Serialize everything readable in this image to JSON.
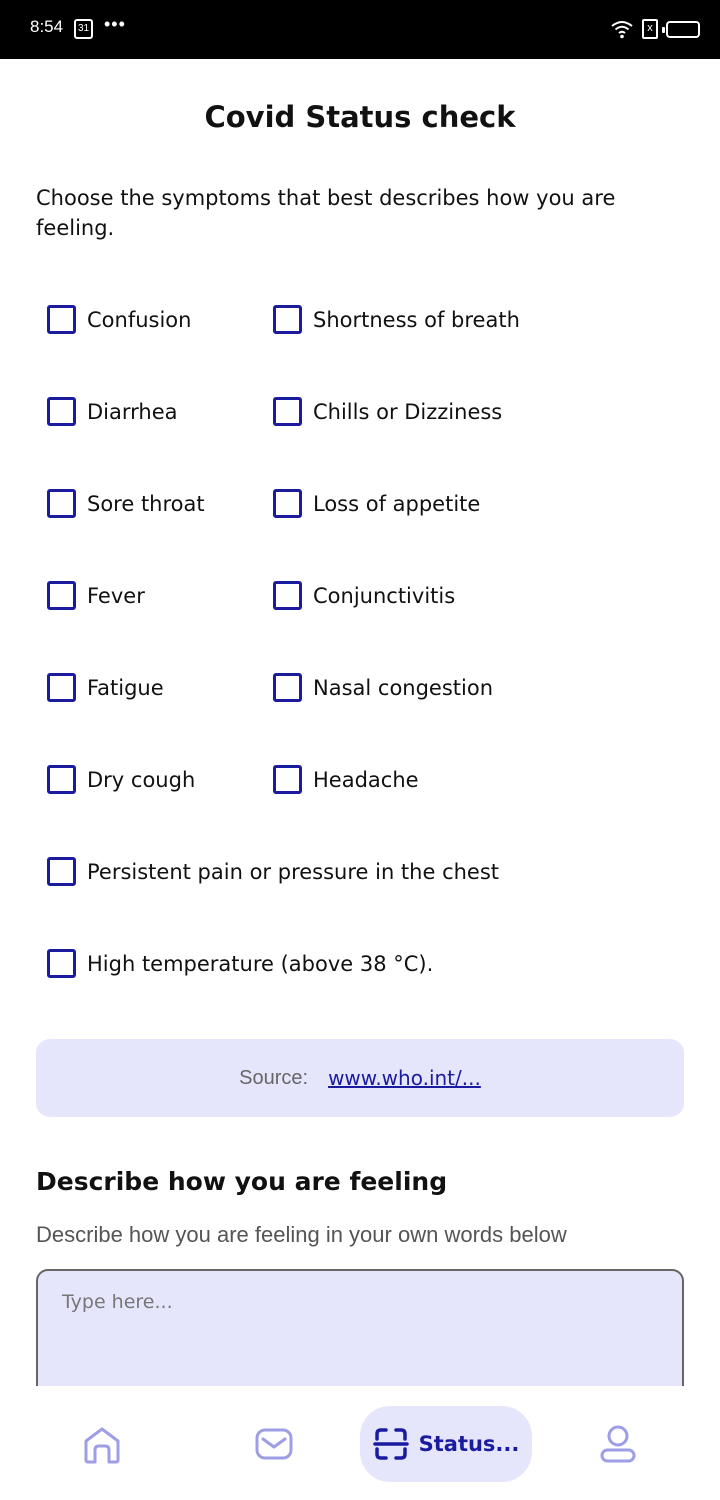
{
  "status_bar": {
    "time": "8:54",
    "calendar_day": "31",
    "dots": "•••",
    "sim_label": "x"
  },
  "header": {
    "title": "Covid Status check"
  },
  "intro": "Choose the symptoms that best describes how you are feeling.",
  "symptoms": [
    {
      "label": "Confusion",
      "checked": false
    },
    {
      "label": "Shortness of breath",
      "checked": false
    },
    {
      "label": "Diarrhea",
      "checked": false
    },
    {
      "label": "Chills or Dizziness",
      "checked": false
    },
    {
      "label": "Sore throat",
      "checked": false
    },
    {
      "label": "Loss of appetite",
      "checked": false
    },
    {
      "label": "Fever",
      "checked": false
    },
    {
      "label": "Conjunctivitis",
      "checked": false
    },
    {
      "label": "Fatigue",
      "checked": false
    },
    {
      "label": "Nasal congestion",
      "checked": false
    },
    {
      "label": "Dry cough",
      "checked": false
    },
    {
      "label": "Headache",
      "checked": false
    },
    {
      "label": "Persistent pain or pressure in the chest",
      "checked": false
    },
    {
      "label": "High temperature (above 38 °C).",
      "checked": false
    }
  ],
  "source": {
    "label": "Source:",
    "link_text": "www.who.int/..."
  },
  "describe": {
    "title": "Describe how you are feeling",
    "subtitle": "Describe how you are feeling in your own words below",
    "placeholder": "Type here...",
    "value": ""
  },
  "bottom_nav": {
    "items": [
      {
        "icon": "home-icon",
        "label": "",
        "active": false
      },
      {
        "icon": "mail-icon",
        "label": "",
        "active": false
      },
      {
        "icon": "scan-icon",
        "label": "Status...",
        "active": true
      },
      {
        "icon": "profile-icon",
        "label": "",
        "active": false
      }
    ]
  },
  "colors": {
    "accent": "#1b1ba0",
    "accent_light": "#e5e6fb",
    "nav_icon": "#9e9ee6"
  }
}
